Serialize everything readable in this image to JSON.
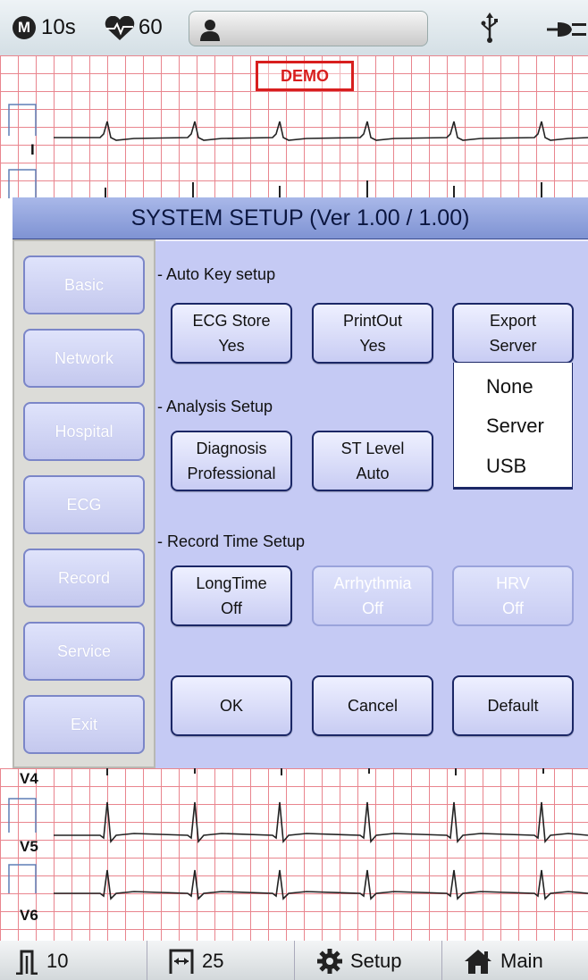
{
  "status_bar": {
    "mode_letter": "M",
    "duration": "10s",
    "heart_rate": "60",
    "icons": [
      "heart-icon",
      "patient-icon",
      "usb-icon",
      "power-plug-icon"
    ]
  },
  "ecg": {
    "demo_label": "DEMO",
    "top_leads": [
      "I"
    ],
    "bottom_leads": [
      "V4",
      "V5",
      "V6"
    ]
  },
  "dialog": {
    "title": "SYSTEM SETUP (Ver 1.00 / 1.00)",
    "sidebar": [
      "Basic",
      "Network",
      "Hospital",
      "ECG",
      "Record",
      "Service",
      "Exit"
    ],
    "sections": {
      "auto_key": "- Auto Key setup",
      "analysis": "- Analysis Setup",
      "record_time": "- Record Time Setup"
    },
    "buttons": {
      "ecg_store": [
        "ECG Store",
        "Yes"
      ],
      "printout": [
        "PrintOut",
        "Yes"
      ],
      "export": [
        "Export",
        "Server"
      ],
      "diagnosis": [
        "Diagnosis",
        "Professional"
      ],
      "st_level": [
        "ST Level",
        "Auto"
      ],
      "longtime": [
        "LongTime",
        "Off"
      ],
      "arrhythmia": [
        "Arrhythmia",
        "Off"
      ],
      "hrv": [
        "HRV",
        "Off"
      ],
      "ok": "OK",
      "cancel": "Cancel",
      "default": "Default"
    },
    "export_options": [
      "None",
      "Server",
      "USB"
    ]
  },
  "bottom_bar": {
    "gain": "10",
    "speed": "25",
    "setup": "Setup",
    "main": "Main",
    "icons": [
      "gain-icon",
      "speed-icon",
      "gear-icon",
      "home-icon"
    ]
  },
  "colors": {
    "grid": "#e9858e",
    "title_bar": "#8c9edb",
    "panel": "#c5caf4",
    "demo": "#d81e1e"
  }
}
